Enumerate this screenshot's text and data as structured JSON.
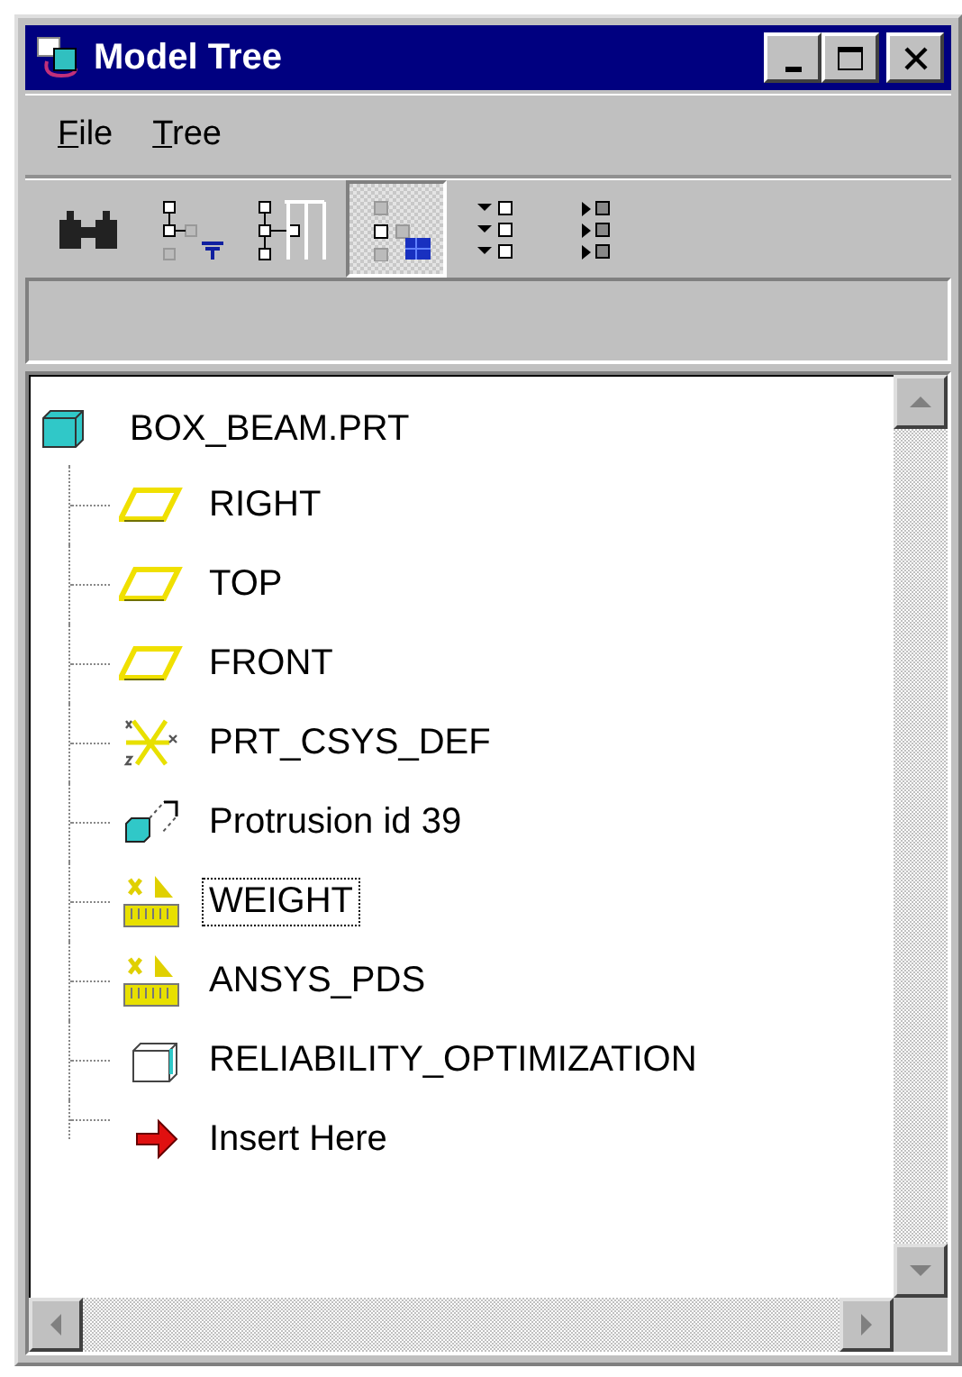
{
  "window": {
    "title": "Model Tree"
  },
  "menu": [
    {
      "label": "File"
    },
    {
      "label": "Tree"
    }
  ],
  "toolbar": [
    {
      "kind": "find",
      "pressed": false
    },
    {
      "kind": "filter",
      "pressed": false
    },
    {
      "kind": "columns",
      "pressed": false
    },
    {
      "kind": "show",
      "pressed": true
    },
    {
      "kind": "expand",
      "pressed": false
    },
    {
      "kind": "collapse",
      "pressed": false
    }
  ],
  "tree": {
    "root": {
      "label": "BOX_BEAM.PRT",
      "kind": "part"
    },
    "children": [
      {
        "label": "RIGHT",
        "kind": "plane",
        "focused": false
      },
      {
        "label": "TOP",
        "kind": "plane",
        "focused": false
      },
      {
        "label": "FRONT",
        "kind": "plane",
        "focused": false
      },
      {
        "label": "PRT_CSYS_DEF",
        "kind": "csys",
        "focused": false
      },
      {
        "label": "Protrusion id 39",
        "kind": "protrusion",
        "focused": false
      },
      {
        "label": "WEIGHT",
        "kind": "analysis",
        "focused": true
      },
      {
        "label": "ANSYS_PDS",
        "kind": "analysis",
        "focused": false
      },
      {
        "label": "RELIABILITY_OPTIMIZATION",
        "kind": "feature",
        "focused": false
      },
      {
        "label": "Insert Here",
        "kind": "insert",
        "focused": false
      }
    ]
  }
}
